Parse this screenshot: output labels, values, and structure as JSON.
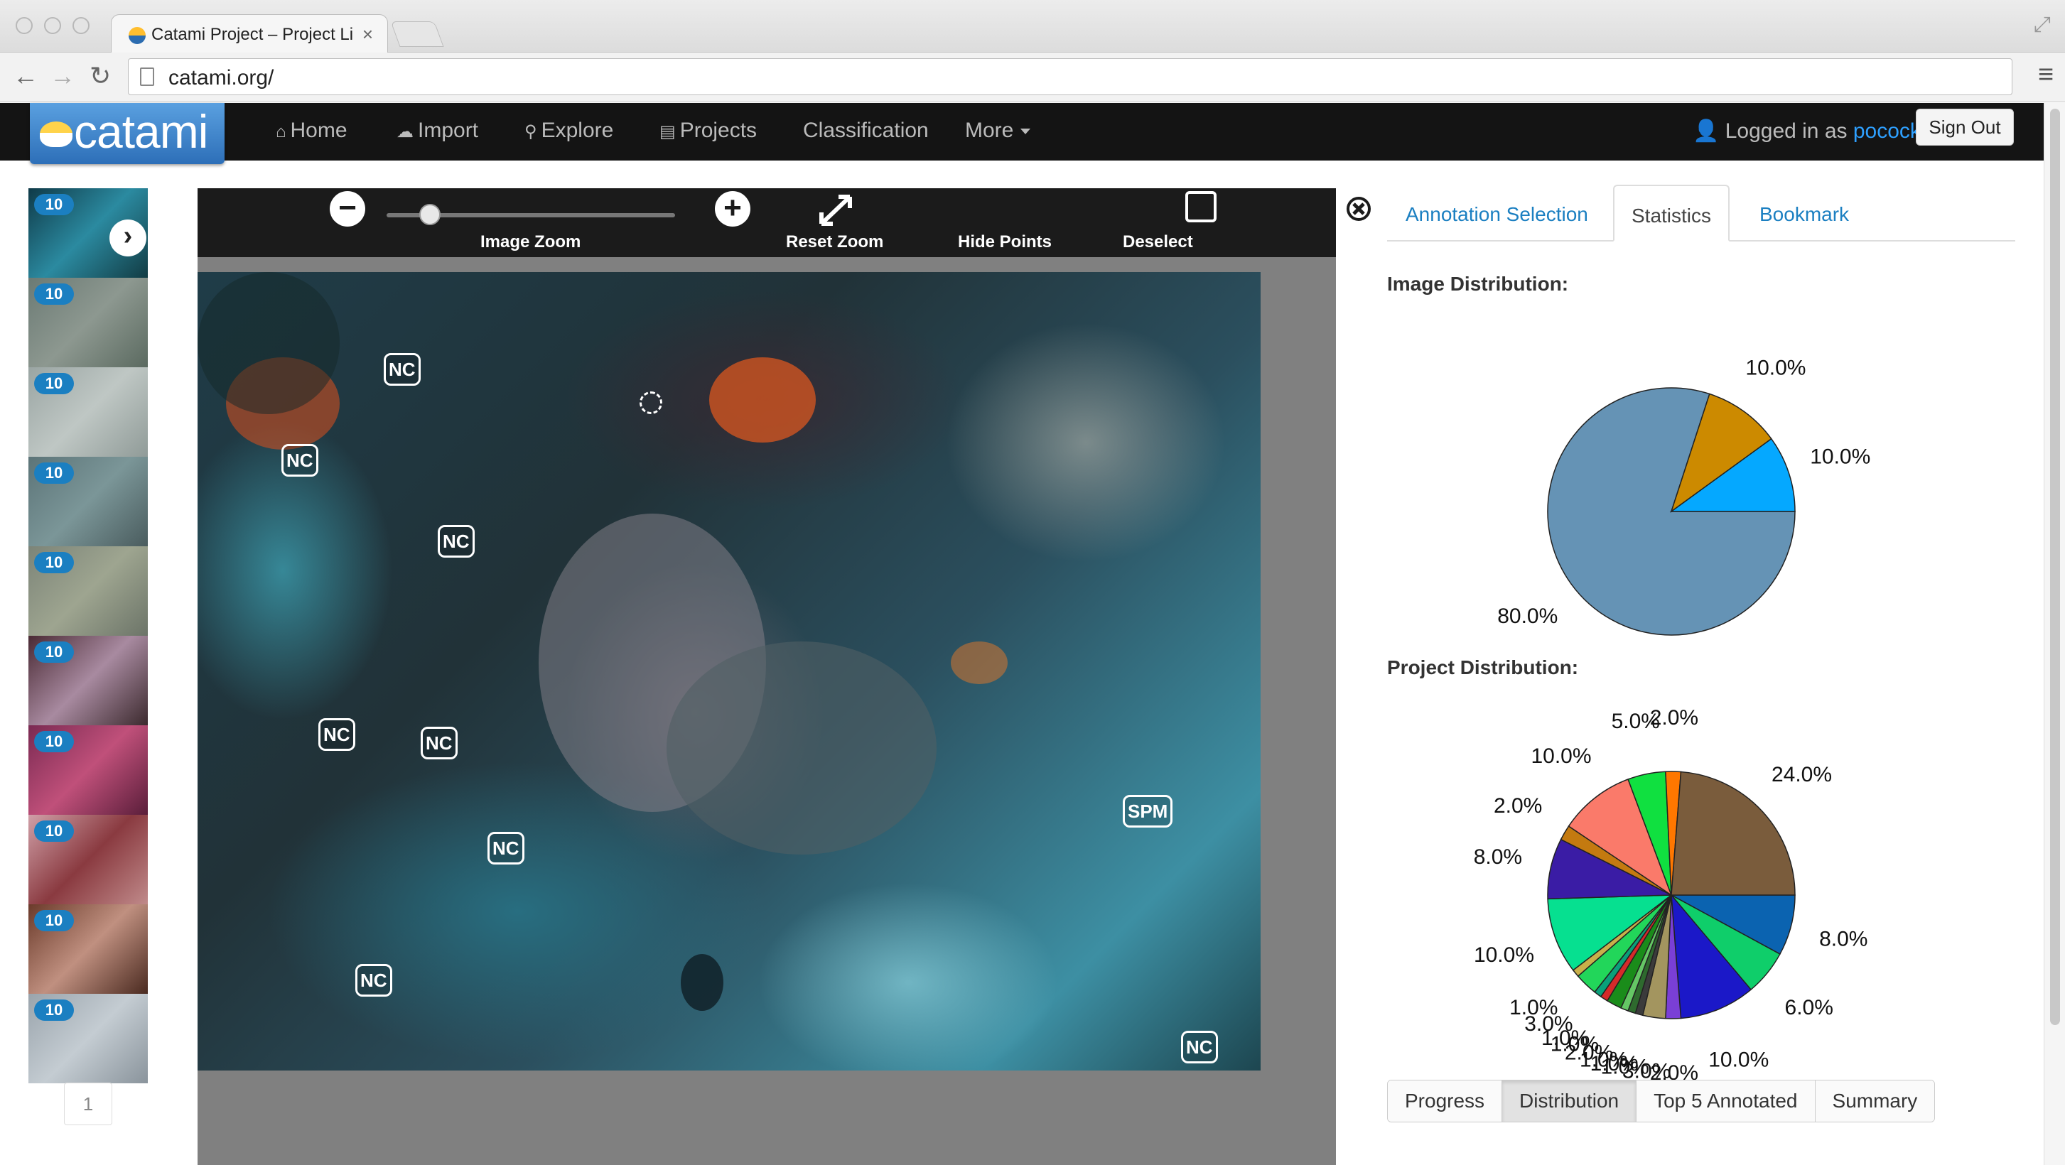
{
  "browser": {
    "tab_title": "Catami Project – Project Li",
    "tab_close": "×",
    "url": "catami.org/"
  },
  "navbar": {
    "logo_text": "catami",
    "items": [
      {
        "label": "Home",
        "icon": "home-icon"
      },
      {
        "label": "Import",
        "icon": "cloud-upload-icon"
      },
      {
        "label": "Explore",
        "icon": "search-icon"
      },
      {
        "label": "Projects",
        "icon": "list-icon"
      },
      {
        "label": "Classification",
        "icon": ""
      },
      {
        "label": "More",
        "icon": "caret-down-icon"
      }
    ],
    "logged_in_prefix": "Logged in as",
    "username": "pocock",
    "sign_out": "Sign Out"
  },
  "thumbnails": {
    "items": [
      {
        "badge": "10"
      },
      {
        "badge": "10"
      },
      {
        "badge": "10"
      },
      {
        "badge": "10"
      },
      {
        "badge": "10"
      },
      {
        "badge": "10"
      },
      {
        "badge": "10"
      },
      {
        "badge": "10"
      },
      {
        "badge": "10"
      },
      {
        "badge": "10"
      }
    ],
    "page": "1"
  },
  "viewer": {
    "toolbar": {
      "zoom_out": "−",
      "zoom_in": "+",
      "zoom_level": 0.15,
      "image_zoom": "Image Zoom",
      "reset_zoom": "Reset Zoom",
      "hide_points": "Hide Points",
      "deselect": "Deselect"
    },
    "points": [
      {
        "label": "NC"
      },
      {
        "label": "NC"
      },
      {
        "label": "NC"
      },
      {
        "label": "NC"
      },
      {
        "label": "NC"
      },
      {
        "label": "NC"
      },
      {
        "label": "NC"
      },
      {
        "label": "SPM"
      },
      {
        "label": "NC"
      }
    ]
  },
  "panel": {
    "tabs": [
      {
        "label": "Annotation Selection",
        "active": false
      },
      {
        "label": "Statistics",
        "active": true
      },
      {
        "label": "Bookmark",
        "active": false
      }
    ],
    "image_distribution_title": "Image Distribution:",
    "project_distribution_title": "Project Distribution:",
    "bottom_buttons": [
      {
        "label": "Progress",
        "active": false
      },
      {
        "label": "Distribution",
        "active": true
      },
      {
        "label": "Top 5 Annotated",
        "active": false
      },
      {
        "label": "Summary",
        "active": false
      }
    ]
  },
  "chart_data": [
    {
      "type": "pie",
      "title": "Image Distribution:",
      "values": [
        80,
        10,
        10
      ],
      "labels": [
        "80.0%",
        "10.0%",
        "10.0%"
      ],
      "colors": [
        "#6593b5",
        "#cc8a00",
        "#05a8ff"
      ]
    },
    {
      "type": "pie",
      "title": "Project Distribution:",
      "values": [
        8,
        6,
        10,
        2,
        3,
        1,
        1,
        1,
        2,
        1,
        1,
        3,
        1,
        10,
        8,
        2,
        10,
        5,
        2,
        24
      ],
      "labels": [
        "8.0%",
        "6.0%",
        "10.0%",
        "2.0%",
        "3.0%",
        "1.0%",
        "1.0%",
        "1.0%",
        "2.0%",
        "1.0%",
        "1.0%",
        "3.0%",
        "1.0%",
        "10.0%",
        "8.0%",
        "2.0%",
        "10.0%",
        "5.0%",
        "2.0%",
        "24.0%"
      ],
      "colors": [
        "#0b63b0",
        "#0fce6a",
        "#1b18c8",
        "#7a3fd6",
        "#a3955f",
        "#3b3b3b",
        "#2e6a2e",
        "#65c765",
        "#1a8c1a",
        "#d62a2a",
        "#0aa07a",
        "#22d65a",
        "#c8b04a",
        "#06e090",
        "#3a1ca5",
        "#c47a10",
        "#fa7a6a",
        "#10e040",
        "#ff7700",
        "#7a5c3c"
      ]
    }
  ]
}
